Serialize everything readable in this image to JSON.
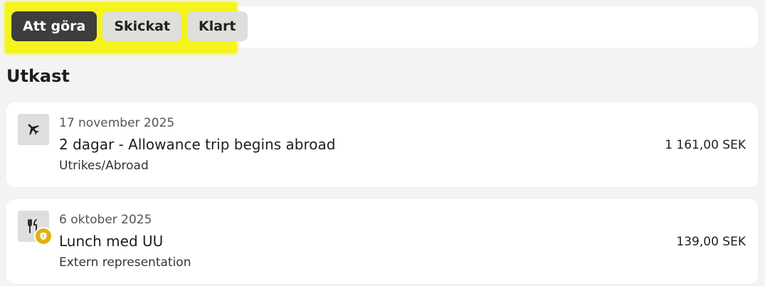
{
  "tabs": [
    {
      "label": "Att göra",
      "active": true
    },
    {
      "label": "Skickat",
      "active": false
    },
    {
      "label": "Klart",
      "active": false
    }
  ],
  "section": {
    "title": "Utkast"
  },
  "expenses": [
    {
      "icon": "airplane-icon",
      "date": "17 november 2025",
      "title": "2 dagar - Allowance trip begins abroad",
      "subtitle": "Utrikes/Abroad",
      "amount": "1 161,00 SEK"
    },
    {
      "icon": "fork-knife-icon",
      "badge": "warning-icon",
      "date": "6 oktober 2025",
      "title": "Lunch med UU",
      "subtitle": "Extern representation",
      "amount": "139,00 SEK"
    }
  ],
  "colors": {
    "background": "#f3f3f3",
    "card": "#ffffff",
    "active_tab": "#3d3d3d",
    "inactive_tab": "#dededb",
    "highlight": "#f4f41c",
    "warning": "#e2b10e"
  }
}
